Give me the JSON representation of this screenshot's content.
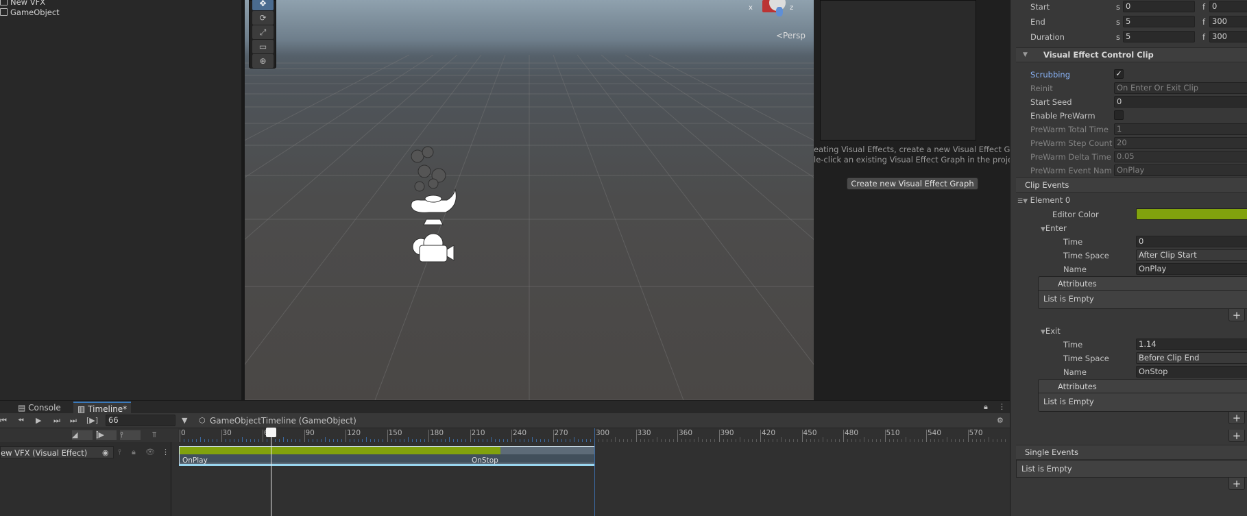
{
  "hierarchy": {
    "items": [
      "New VFX",
      "GameObject"
    ]
  },
  "scene": {
    "persp_label": "<Persp",
    "gizmo_x": "x",
    "gizmo_z": "z",
    "tools": [
      "move",
      "rotate",
      "scale",
      "rect",
      "transform"
    ]
  },
  "preview": {
    "info_line1": "eating Visual Effects, create a new Visual Effect G",
    "info_line2": "le-click an existing Visual Effect Graph in the proje",
    "create_button": "Create new Visual Effect Graph"
  },
  "inspector": {
    "start": {
      "label": "Start",
      "s_prefix": "s",
      "s_value": "0",
      "f_prefix": "f",
      "f_value": "0"
    },
    "end": {
      "label": "End",
      "s_prefix": "s",
      "s_value": "5",
      "f_prefix": "f",
      "f_value": "300"
    },
    "duration": {
      "label": "Duration",
      "s_prefix": "s",
      "s_value": "5",
      "f_prefix": "f",
      "f_value": "300"
    },
    "vfx_section": "Visual Effect Control Clip",
    "scrubbing": "Scrubbing",
    "reinit": "Reinit",
    "reinit_value": "On Enter Or Exit Clip",
    "start_seed": "Start Seed",
    "start_seed_value": "0",
    "enable_prewarm": "Enable PreWarm",
    "prewarm_total": "PreWarm Total Time",
    "prewarm_total_value": "1",
    "prewarm_step": "PreWarm Step Count",
    "prewarm_step_value": "20",
    "prewarm_delta": "PreWarm Delta Time",
    "prewarm_delta_value": "0.05",
    "prewarm_event": "PreWarm Event Name",
    "prewarm_event_value": "OnPlay",
    "clip_events": "Clip Events",
    "element0": "Element 0",
    "editor_color": "Editor Color",
    "editor_color_hex": "#81a20d",
    "enter": "Enter",
    "exit": "Exit",
    "time": "Time",
    "enter_time": "0",
    "exit_time": "1.14",
    "time_space": "Time Space",
    "enter_space": "After Clip Start",
    "exit_space": "Before Clip End",
    "name": "Name",
    "enter_name": "OnPlay",
    "exit_name": "OnStop",
    "attributes": "Attributes",
    "list_empty": "List is Empty",
    "single_events": "Single Events",
    "plus": "+"
  },
  "timeline": {
    "tab_console": "Console",
    "tab_timeline": "Timeline*",
    "frame": "66",
    "breadcrumb": "GameObjectTimeline (GameObject)",
    "track_name": "ew VFX (Visual Effect)",
    "ticks": [
      "0",
      "30",
      "60",
      "90",
      "120",
      "150",
      "180",
      "210",
      "240",
      "270",
      "300",
      "330",
      "360",
      "390",
      "420",
      "450",
      "480",
      "510",
      "540",
      "570"
    ],
    "event_start": "OnPlay",
    "event_end": "OnStop"
  }
}
